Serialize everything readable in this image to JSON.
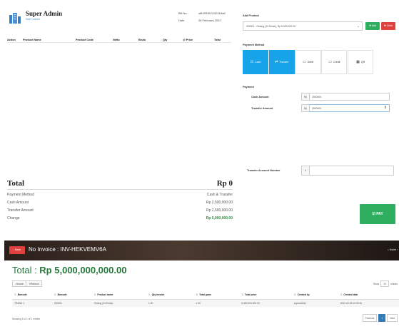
{
  "header": {
    "admin_name": "Super Admin",
    "admin_sub": "Staff Cashier",
    "bill_no_label": "Bill No :",
    "bill_no_value": "s8HZR8C0152218a8",
    "date_label": "Date",
    "date_value": "28 February 2022"
  },
  "cart_columns": [
    "Action",
    "Product Name",
    "Product Code",
    "Netto",
    "Bruto",
    "Qty",
    "@ Price",
    "Total"
  ],
  "summary": {
    "total_label": "Total",
    "total_value": "Rp 0",
    "rows": [
      {
        "label": "Payment Method",
        "value": "Cash & Transfer"
      },
      {
        "label": "Cash Amount",
        "value": "Rp 2,500,000.00"
      },
      {
        "label": "Transfer Amount",
        "value": "Rp 2,500,000.00"
      },
      {
        "label": "Change",
        "value": "Rp 5,000,000.00"
      }
    ]
  },
  "add_product": {
    "label": "Add Product",
    "selected": "000001 - Gelang (24 Emas), Rp 5,000,000.00",
    "add_label": "Add",
    "clear_label": "Clear"
  },
  "payment_method": {
    "label": "Payment Method",
    "options": [
      {
        "label": "Cash",
        "icon": "cash-icon",
        "glyph": "☷"
      },
      {
        "label": "Transfer",
        "icon": "transfer-icon",
        "glyph": "⇄"
      },
      {
        "label": "Debit",
        "icon": "debit-card-icon",
        "glyph": "▭"
      },
      {
        "label": "Credit",
        "icon": "credit-card-icon",
        "glyph": "▭"
      },
      {
        "label": "QR",
        "icon": "qr-code-icon",
        "glyph": "▦"
      }
    ]
  },
  "payment": {
    "label": "Payment",
    "cash_label": "Cash Amount",
    "cash_prefix": "Rp",
    "cash_value": "2500000",
    "transfer_label": "Transfer Amount",
    "transfer_prefix": "Rp",
    "transfer_value": "2500000",
    "account_label": "Transfer Account Number",
    "account_prefix": "#"
  },
  "pay_button": {
    "label": "PAY",
    "glyph": "☑"
  },
  "invoice": {
    "back_label": "‹ Back",
    "title": "No Invoice : INV-HEKVEMV6A",
    "breadcrumb": "Home ›",
    "total_label": "Total : ",
    "total_value": "Rp 5,000,000,000.00",
    "search_label": "Search",
    "refresh_label": "Refresh",
    "show_label": "Show",
    "show_value": "10",
    "entries_label": "entries",
    "columns": [
      "Barcode",
      "Barcode",
      "Product name",
      "Qty invoice",
      "Total gram",
      "Total price",
      "Created by",
      "Created date"
    ],
    "rows": [
      [
        "TRANS 1",
        "000001",
        "Gelang (24 Emas)",
        "1.00",
        "1.00",
        "5,000,000,000.00",
        "superadmin",
        "2022-02-28 10:50:51"
      ]
    ],
    "info": "Showing 1 to 1 of 1 entries",
    "prev_label": "Previous",
    "page": "1",
    "next_label": "Next"
  }
}
